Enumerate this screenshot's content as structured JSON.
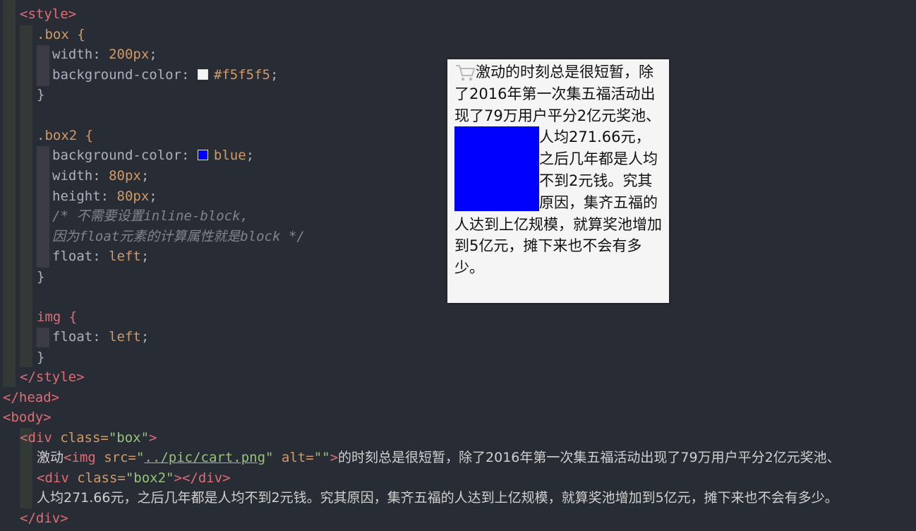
{
  "code": {
    "l1_indent": "  ",
    "style_open": "<style>",
    "box_selector": ".box {",
    "width_prop": "width: ",
    "width_val": "200px",
    "bg_prop": "background-color: ",
    "bg_val": "#f5f5f5",
    "close_brace": "}",
    "box2_selector": ".box2 {",
    "bg2_val": "blue",
    "width2_val": "80px",
    "height_prop": "height: ",
    "height2_val": "80px",
    "comment1": "/* 不需要设置inline-block,",
    "comment2": "因为float元素的计算属性就是block */",
    "float_prop": "float: ",
    "float_val": "left",
    "img_selector": "img {",
    "style_close": "</style>",
    "head_close": "</head>",
    "body_open": "<body>",
    "div_open_tag": "<div",
    "class_attr": " class=",
    "box_class": "\"box\"",
    "text1": "激动",
    "img_tag": "<img",
    "src_attr": " src=",
    "src_val": "../pic/cart.png",
    "alt_attr": " alt=",
    "alt_val": "\"\"",
    "text2": "的时刻总是很短暂，除了2016年第一次集五福活动出现了79万用户平分2亿元奖池、",
    "box2_class": "\"box2\"",
    "div_close": "</div>",
    "text3": "人均271.66元，之后几年都是人均不到2元钱。究其原因，集齐五福的人达到上亿规模，就算奖池增加到5亿元，摊下来也不会有多少。",
    "div_close_final": "</div>"
  },
  "preview": {
    "para_part1": "激动的时刻总是很短暂，除了2016年第一次集五福活动出现了79万用户平分2亿元奖池、",
    "para_part2": " 人均271.66元，之后几年都是人均不到2元钱。究其原因，集齐五福的人达到上亿规模，就算奖池增加到5亿元，摊下来也不会有多少。"
  },
  "colors": {
    "editor_bg": "#282c34",
    "swatch_f5": "#f5f5f5",
    "swatch_blue": "#0000ff"
  },
  "icons": {
    "cart": "cart-icon"
  }
}
